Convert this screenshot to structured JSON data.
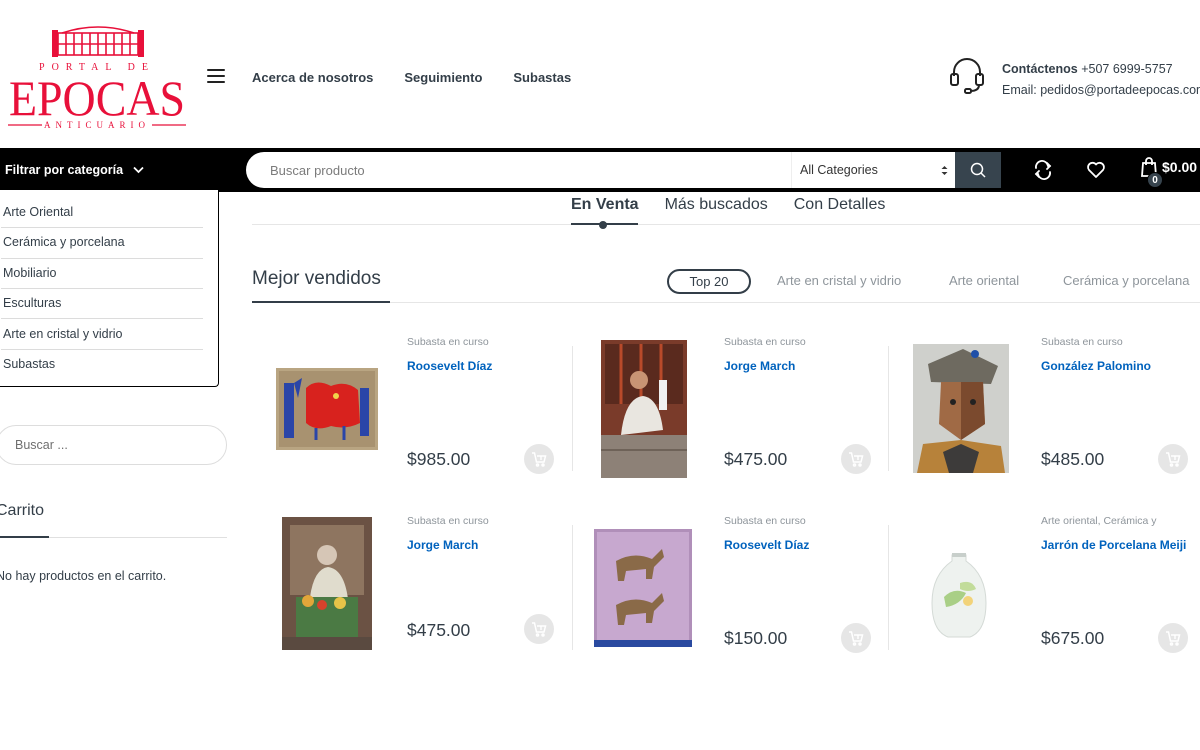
{
  "header": {
    "logo_lines": [
      "PORTAL DE",
      "EPOCAS",
      "ANTICUARIO"
    ],
    "nav": [
      "Acerca de nosotros",
      "Seguimiento",
      "Subastas"
    ],
    "contact_label": "Contáctenos",
    "contact_phone": "+507 6999-5757",
    "contact_email": "Email: pedidos@portadeepocas.com"
  },
  "toolbar": {
    "filter_label": "Filtrar por categoría",
    "search_placeholder": "Buscar producto",
    "category_select": "All Categories",
    "cart_total": "$0.00",
    "cart_count": "0"
  },
  "categories": [
    "Arte Oriental",
    "Cerámica y porcelana",
    "Mobiliario",
    "Esculturas",
    "Arte en cristal y vidrio",
    "Subastas"
  ],
  "sidebar": {
    "search_placeholder": "Buscar ...",
    "cart_title": "Carrito",
    "cart_empty": "No hay productos en el carrito."
  },
  "tabs": [
    "En Venta",
    "Más buscados",
    "Con Detalles"
  ],
  "section": {
    "title": "Mejor vendidos",
    "filters": [
      "Top 20",
      "Arte en cristal y vidrio",
      "Arte oriental",
      "Cerámica y porcelana"
    ]
  },
  "products": [
    {
      "category": "Subasta en curso",
      "name": "Roosevelt Díaz",
      "price": "$985.00"
    },
    {
      "category": "Subasta en curso",
      "name": "Jorge March",
      "price": "$475.00"
    },
    {
      "category": "Subasta en curso",
      "name": "González Palomino",
      "price": "$485.00"
    },
    {
      "category": "Subasta en curso",
      "name": "Jorge March",
      "price": "$475.00"
    },
    {
      "category": "Subasta en curso",
      "name": "Roosevelt Díaz",
      "price": "$150.00"
    },
    {
      "category": "Arte oriental, Cerámica y",
      "name": "Jarrón de Porcelana Meiji",
      "price": "$675.00"
    }
  ],
  "colors": {
    "brand_red": "#e8103a",
    "dark": "#333e48",
    "link_blue": "#0062bd"
  }
}
